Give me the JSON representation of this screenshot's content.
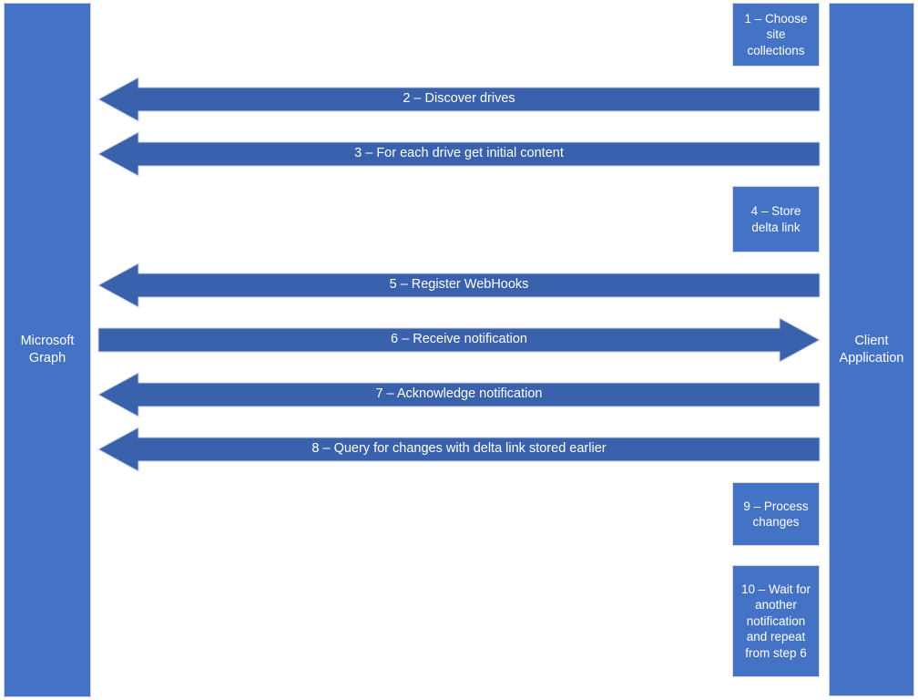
{
  "diagram": {
    "type": "sequence-diagram",
    "background_color": "#ffffff",
    "accent_color": "#4472c4",
    "arrow_color": "#3a61ab",
    "text_color": "#ffffff",
    "actors": [
      {
        "id": "microsoft-graph",
        "label": "Microsoft\nGraph",
        "side": "left"
      },
      {
        "id": "client-application",
        "label": "Client\nApplication",
        "side": "right"
      }
    ],
    "process_boxes": [
      {
        "id": "step-1",
        "label": "1 – Choose\nsite\ncollections"
      },
      {
        "id": "step-4",
        "label": "4 – Store\ndelta link"
      },
      {
        "id": "step-9",
        "label": "9 – Process\nchanges"
      },
      {
        "id": "step-10",
        "label": "10 – Wait for\nanother\nnotification\nand repeat\nfrom step 6"
      }
    ],
    "messages": [
      {
        "id": "step-2",
        "label": "2 – Discover drives",
        "direction": "left"
      },
      {
        "id": "step-3",
        "label": "3 – For each drive get initial content",
        "direction": "left"
      },
      {
        "id": "step-5",
        "label": "5 – Register WebHooks",
        "direction": "left"
      },
      {
        "id": "step-6",
        "label": "6 – Receive notification",
        "direction": "right"
      },
      {
        "id": "step-7",
        "label": "7 – Acknowledge notification",
        "direction": "left"
      },
      {
        "id": "step-8",
        "label": "8 – Query for changes with delta link stored earlier",
        "direction": "left"
      }
    ]
  }
}
